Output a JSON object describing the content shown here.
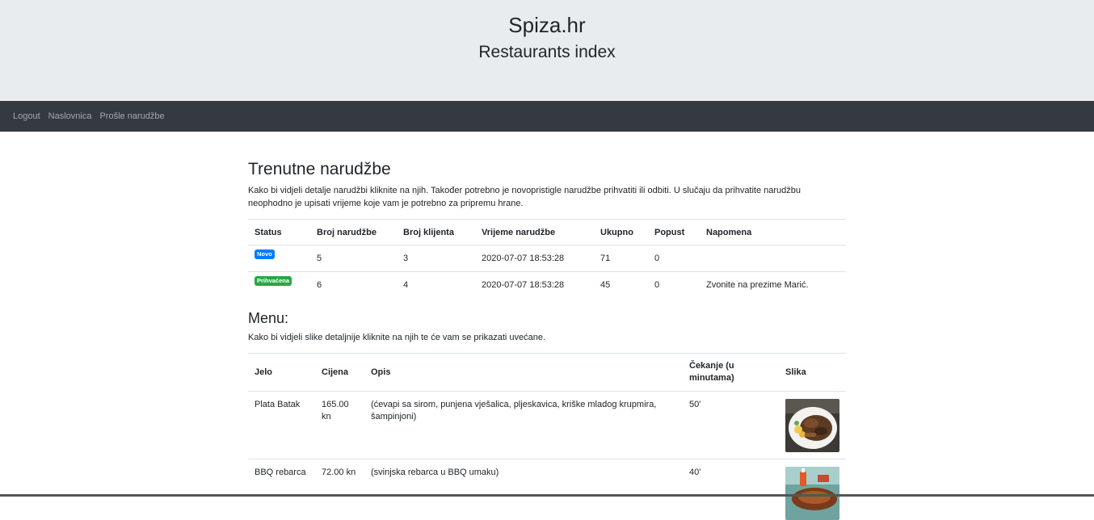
{
  "header": {
    "site": "Spiza.hr",
    "subtitle": "Restaurants index"
  },
  "nav": {
    "items": [
      "Logout",
      "Naslovnica",
      "Prošle narudžbe"
    ]
  },
  "orders": {
    "title": "Trenutne narudžbe",
    "desc": "Kako bi vidjeli detalje narudžbi kliknite na njih. Također potrebno je novopristigle narudžbe prihvatiti ili odbiti. U slučaju da prihvatite narudžbu neophodno je upisati vrijeme koje vam je potrebno za pripremu hrane.",
    "columns": [
      "Status",
      "Broj narudžbe",
      "Broj klijenta",
      "Vrijeme narudžbe",
      "Ukupno",
      "Popust",
      "Napomena"
    ],
    "rows": [
      {
        "status": "Novo",
        "number": "5",
        "client": "3",
        "time": "2020-07-07 18:53:28",
        "total": "71",
        "discount": "0",
        "note": ""
      },
      {
        "status": "Prihvaćena",
        "number": "6",
        "client": "4",
        "time": "2020-07-07 18:53:28",
        "total": "45",
        "discount": "0",
        "note": "Zvonite na prezime Marić."
      }
    ],
    "status_colors": {
      "Novo": "#007bff",
      "Prihvaćena": "#28a745"
    }
  },
  "menu": {
    "title": "Menu:",
    "desc": "Kako bi vidjeli slike detaljnije kliknite na njih te će vam se prikazati uvećane.",
    "columns": [
      "Jelo",
      "Cijena",
      "Opis",
      "Čekanje (u minutama)",
      "Slika"
    ],
    "rows": [
      {
        "name": "Plata Batak",
        "price": "165.00 kn",
        "desc": "(ćevapi sa sirom, punjena vješalica, pljeskavica, kriške mladog krupmira, šampinjoni)",
        "wait": "50'",
        "image": "food-platter-photo"
      },
      {
        "name": "BBQ rebarca",
        "price": "72.00 kn",
        "desc": "(svinjska rebarca u BBQ umaku)",
        "wait": "40'",
        "image": "bbq-ribs-photo"
      }
    ]
  }
}
